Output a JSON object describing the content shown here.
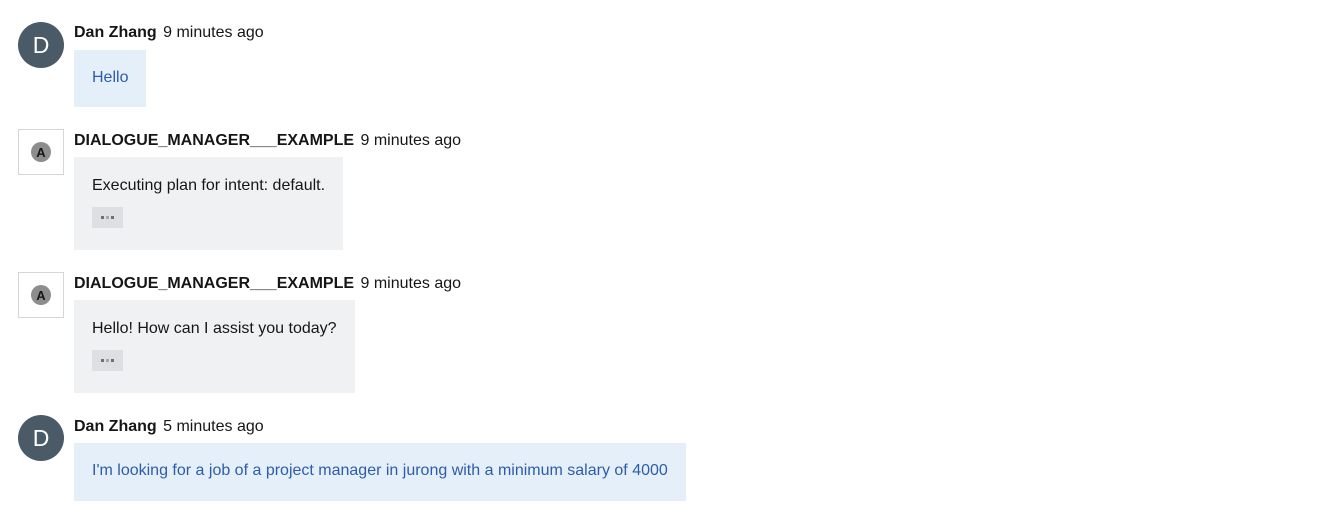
{
  "messages": [
    {
      "sender": "Dan Zhang",
      "time": "9 minutes ago",
      "avatar_letter": "D",
      "text": "Hello"
    },
    {
      "sender": "DIALOGUE_MANAGER___EXAMPLE",
      "time": "9 minutes ago",
      "avatar_letter": "A",
      "text": "Executing plan for intent: default."
    },
    {
      "sender": "DIALOGUE_MANAGER___EXAMPLE",
      "time": "9 minutes ago",
      "avatar_letter": "A",
      "text": "Hello! How can I assist you today?"
    },
    {
      "sender": "Dan Zhang",
      "time": "5 minutes ago",
      "avatar_letter": "D",
      "text": "I'm looking for a job of a project manager in jurong with a minimum salary of 4000"
    }
  ],
  "colors": {
    "user_avatar": "#4a5a66",
    "user_bubble": "#e5effa",
    "user_text": "#2d5da8",
    "bot_bubble": "#f0f1f3"
  }
}
